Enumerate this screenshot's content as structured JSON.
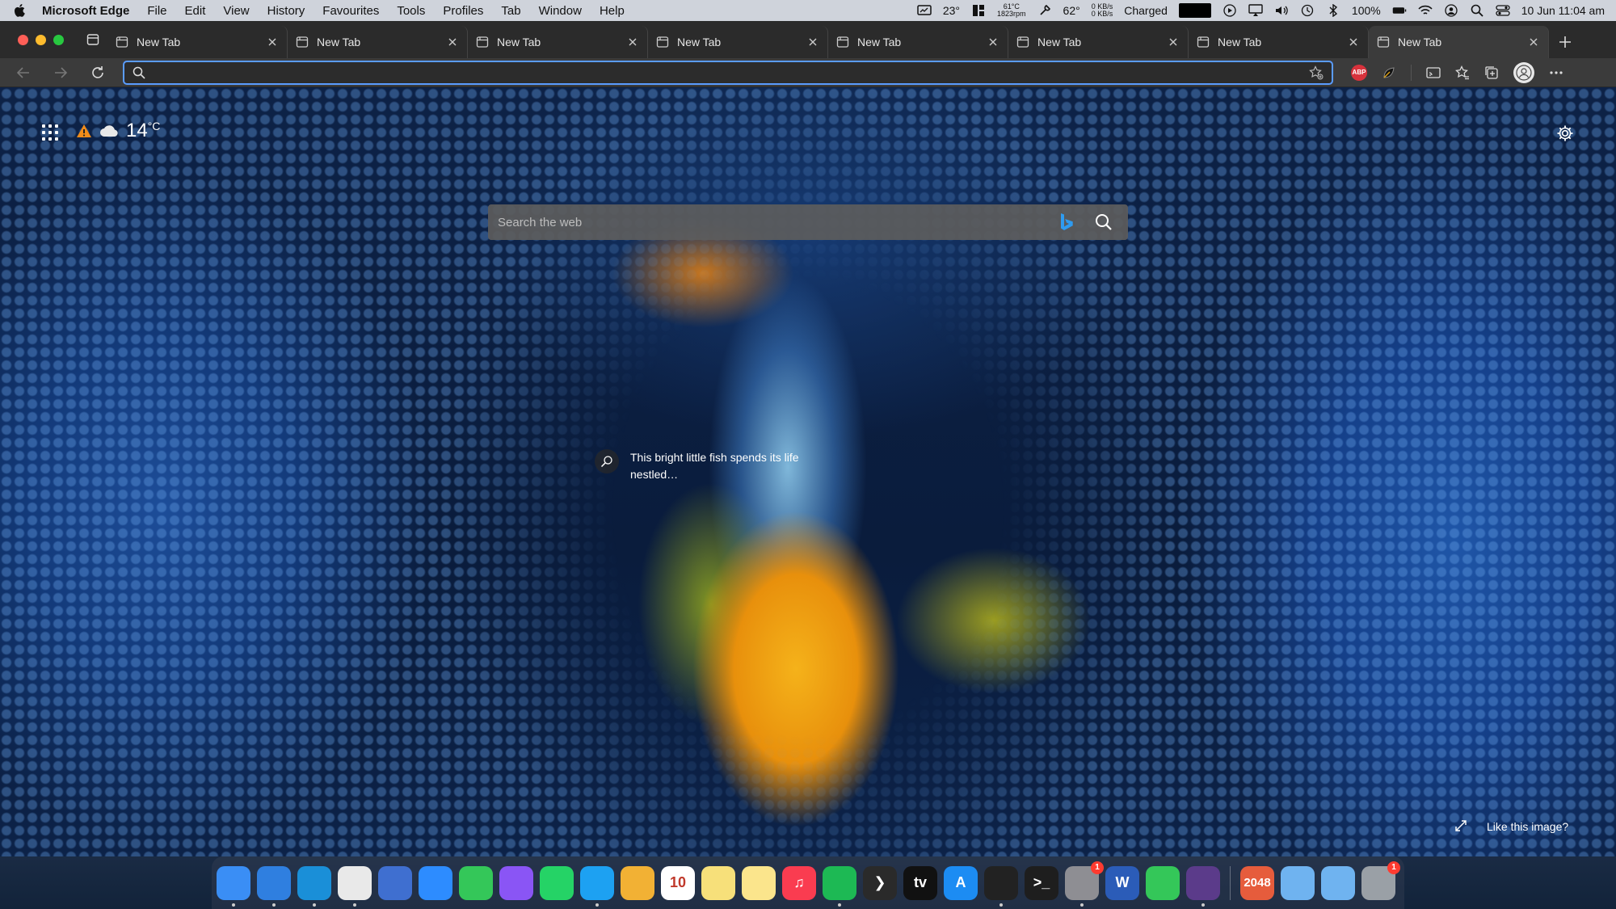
{
  "menubar": {
    "app_name": "Microsoft Edge",
    "menus": [
      "File",
      "Edit",
      "View",
      "History",
      "Favourites",
      "Tools",
      "Profiles",
      "Tab",
      "Window",
      "Help"
    ],
    "status": {
      "weather_temp": "23°",
      "cpu_temp": "61°C",
      "fan_rpm": "1823rpm",
      "sensor_temp": "62°",
      "net_up": "0 KB/s",
      "net_down": "0 KB/s",
      "battery_label": "Charged",
      "battery_percent": "100%",
      "date_time": "10 Jun  11:04 am"
    }
  },
  "tabs": [
    {
      "title": "New Tab",
      "active": false
    },
    {
      "title": "New Tab",
      "active": false
    },
    {
      "title": "New Tab",
      "active": false
    },
    {
      "title": "New Tab",
      "active": false
    },
    {
      "title": "New Tab",
      "active": false
    },
    {
      "title": "New Tab",
      "active": false
    },
    {
      "title": "New Tab",
      "active": false
    },
    {
      "title": "New Tab",
      "active": true
    }
  ],
  "address_bar": {
    "value": "",
    "placeholder": ""
  },
  "extensions": {
    "abp_label": "ABP"
  },
  "newtab": {
    "weather": {
      "temp": "14",
      "unit": "°C"
    },
    "search": {
      "placeholder": "Search the web"
    },
    "caption": "This bright little fish spends its life nestled…",
    "like_image": "Like this image?"
  },
  "dock": {
    "apps": [
      {
        "name": "finder",
        "color": "#3a8ef5",
        "label": "",
        "running": true
      },
      {
        "name": "safari",
        "color": "#2f7fe0",
        "label": "",
        "running": true
      },
      {
        "name": "edge",
        "color": "#1a8fd8",
        "label": "",
        "running": true
      },
      {
        "name": "chrome",
        "color": "#e9e9e9",
        "label": "",
        "running": true
      },
      {
        "name": "maps",
        "color": "#3f6fd0",
        "label": "",
        "running": false
      },
      {
        "name": "zoom",
        "color": "#2d8cff",
        "label": "",
        "running": false
      },
      {
        "name": "messages",
        "color": "#34c759",
        "label": "",
        "running": false
      },
      {
        "name": "messenger",
        "color": "#8a55f5",
        "label": "",
        "running": false
      },
      {
        "name": "whatsapp",
        "color": "#25d366",
        "label": "",
        "running": false
      },
      {
        "name": "twitter",
        "color": "#1da1f2",
        "label": "",
        "running": true
      },
      {
        "name": "photos",
        "color": "#f2b134",
        "label": "",
        "running": false
      },
      {
        "name": "calendar",
        "color": "#ffffff",
        "label": "10",
        "running": false
      },
      {
        "name": "stickies",
        "color": "#f7e07a",
        "label": "",
        "running": false
      },
      {
        "name": "notes",
        "color": "#fbe58c",
        "label": "",
        "running": false
      },
      {
        "name": "music",
        "color": "#fa3c50",
        "label": "♫",
        "running": false
      },
      {
        "name": "spotify",
        "color": "#1db954",
        "label": "",
        "running": true
      },
      {
        "name": "prompt",
        "color": "#2a2a2a",
        "label": "❯",
        "running": false
      },
      {
        "name": "apple-tv",
        "color": "#111111",
        "label": "tv",
        "running": false
      },
      {
        "name": "app-store",
        "color": "#1c8cf3",
        "label": "A",
        "running": false
      },
      {
        "name": "activity-monitor",
        "color": "#222222",
        "label": "",
        "running": true
      },
      {
        "name": "terminal",
        "color": "#1e1e1e",
        "label": ">_",
        "running": false
      },
      {
        "name": "system-preferences",
        "color": "#8e8e93",
        "label": "",
        "running": true,
        "badge": "1"
      },
      {
        "name": "word",
        "color": "#2b5cb8",
        "label": "W",
        "running": false
      },
      {
        "name": "facetime",
        "color": "#34c759",
        "label": "",
        "running": false
      },
      {
        "name": "alfred",
        "color": "#5b3b8a",
        "label": "",
        "running": true
      },
      {
        "name": "2048",
        "color": "#e65c3c",
        "label": "2048",
        "running": false
      },
      {
        "name": "downloads-folder",
        "color": "#6fb3f0",
        "label": "",
        "running": false
      },
      {
        "name": "documents-folder",
        "color": "#6fb3f0",
        "label": "",
        "running": false
      },
      {
        "name": "trash",
        "color": "#9aa0a6",
        "label": "",
        "running": false,
        "badge": "1"
      }
    ]
  }
}
